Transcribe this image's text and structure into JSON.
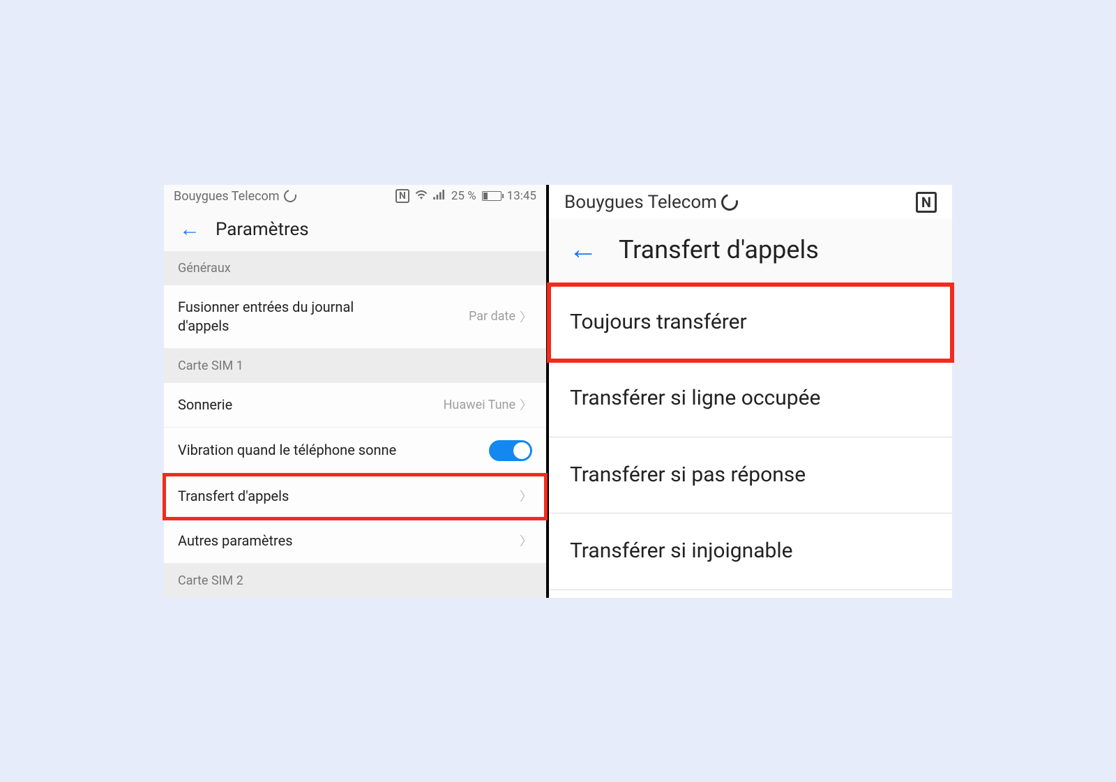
{
  "left_screen": {
    "statusbar": {
      "carrier": "Bouygues Telecom",
      "battery_pct": "25 %",
      "time": "13:45"
    },
    "header": {
      "title": "Paramètres"
    },
    "sections": {
      "general_label": "Généraux",
      "merge_call_log": {
        "label": "Fusionner entrées du journal d'appels",
        "value": "Par date"
      },
      "sim1_label": "Carte SIM 1",
      "ringtone": {
        "label": "Sonnerie",
        "value": "Huawei Tune"
      },
      "vibrate": {
        "label": "Vibration quand le téléphone sonne",
        "on": true
      },
      "call_forwarding": {
        "label": "Transfert d'appels"
      },
      "other_settings": {
        "label": "Autres paramètres"
      },
      "sim2_label": "Carte SIM 2"
    }
  },
  "right_screen": {
    "statusbar": {
      "carrier": "Bouygues Telecom"
    },
    "header": {
      "title": "Transfert d'appels"
    },
    "options": {
      "always": "Toujours transférer",
      "busy": "Transférer si ligne occupée",
      "no_answer": "Transférer si pas réponse",
      "unreachable": "Transférer si injoignable"
    }
  }
}
